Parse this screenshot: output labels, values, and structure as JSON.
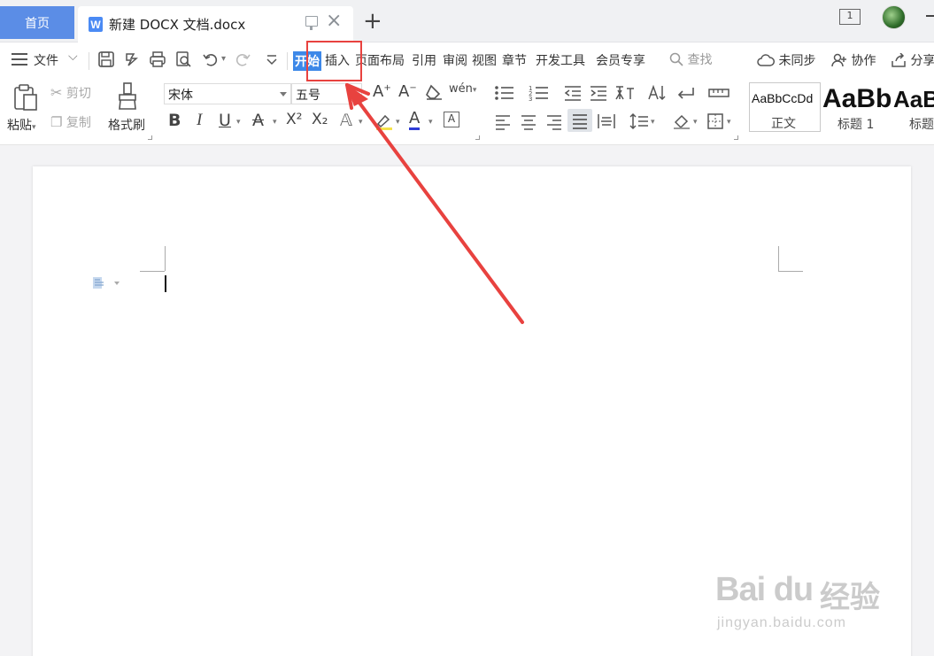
{
  "tabs": {
    "home": "首页",
    "document": "新建 DOCX 文档.docx",
    "doc_icon_letter": "W",
    "new_tab": "+",
    "close": "×"
  },
  "topbar": {
    "window_count": "1"
  },
  "menu": {
    "file": "文件",
    "items": [
      "开始",
      "插入",
      "页面布局",
      "引用",
      "审阅",
      "视图",
      "章节",
      "开发工具",
      "会员专享"
    ],
    "active": "开始",
    "search": "查找",
    "sync": "未同步",
    "collab": "协作",
    "share": "分享"
  },
  "ribbon": {
    "paste": "粘贴",
    "cut": "剪切",
    "copy": "复制",
    "format_painter": "格式刷",
    "font_name": "宋体",
    "font_size": "五号",
    "wen": "wén",
    "bold": "B",
    "italic": "I",
    "underline": "U",
    "superscript": "X²",
    "subscript": "X₂",
    "styles": [
      {
        "preview": "AaBbCcDd",
        "name": "正文"
      },
      {
        "preview": "AaBb",
        "name": "标题 1"
      },
      {
        "preview": "AaB",
        "name": "标题"
      }
    ]
  },
  "watermark": {
    "logo": "Bai du",
    "cn": "经验",
    "url": "jingyan.baidu.com"
  },
  "colors": {
    "accent": "#3d88e8",
    "home_tab": "#5b8de6",
    "annotation": "#e8423f"
  }
}
